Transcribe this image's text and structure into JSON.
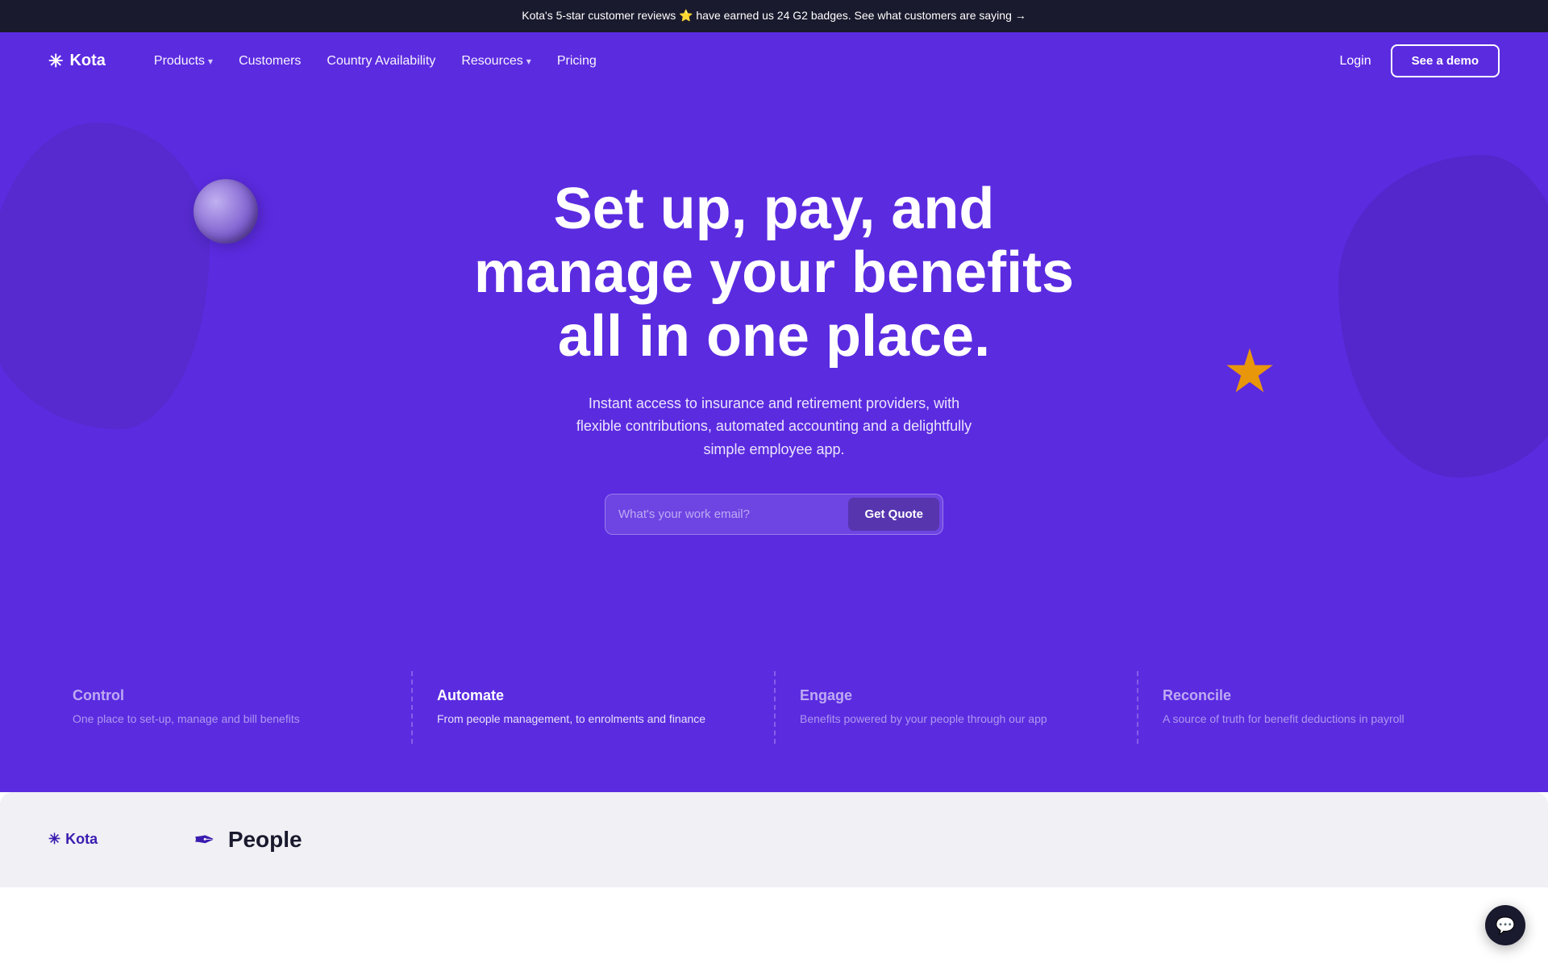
{
  "announcement": {
    "text": "Kota's 5-star customer reviews ⭐ have earned us 24 G2 badges. See what customers are saying →"
  },
  "nav": {
    "logo_text": "Kota",
    "logo_icon": "✳",
    "links": [
      {
        "label": "Products",
        "has_dropdown": true
      },
      {
        "label": "Customers",
        "has_dropdown": false
      },
      {
        "label": "Country Availability",
        "has_dropdown": false
      },
      {
        "label": "Resources",
        "has_dropdown": true
      },
      {
        "label": "Pricing",
        "has_dropdown": false
      }
    ],
    "login_label": "Login",
    "cta_label": "See a demo"
  },
  "hero": {
    "title": "Set up, pay, and manage your benefits all in one place.",
    "subtitle": "Instant access to insurance and retirement providers, with flexible contributions, automated accounting and a delightfully simple employee app.",
    "input_placeholder": "What's your work email?",
    "cta_label": "Get Quote"
  },
  "features": [
    {
      "title": "Control",
      "desc": "One place to set-up, manage and bill benefits",
      "active": false
    },
    {
      "title": "Automate",
      "desc": "From people management, to enrolments and finance",
      "active": true
    },
    {
      "title": "Engage",
      "desc": "Benefits powered by your people through our app",
      "active": false
    },
    {
      "title": "Reconcile",
      "desc": "A source of truth for benefit deductions in payroll",
      "active": false
    }
  ],
  "bottom": {
    "logo_icon": "✳",
    "logo_text": "Kota",
    "people_icon": "✒",
    "people_title": "People"
  },
  "chat": {
    "icon": "💬"
  }
}
